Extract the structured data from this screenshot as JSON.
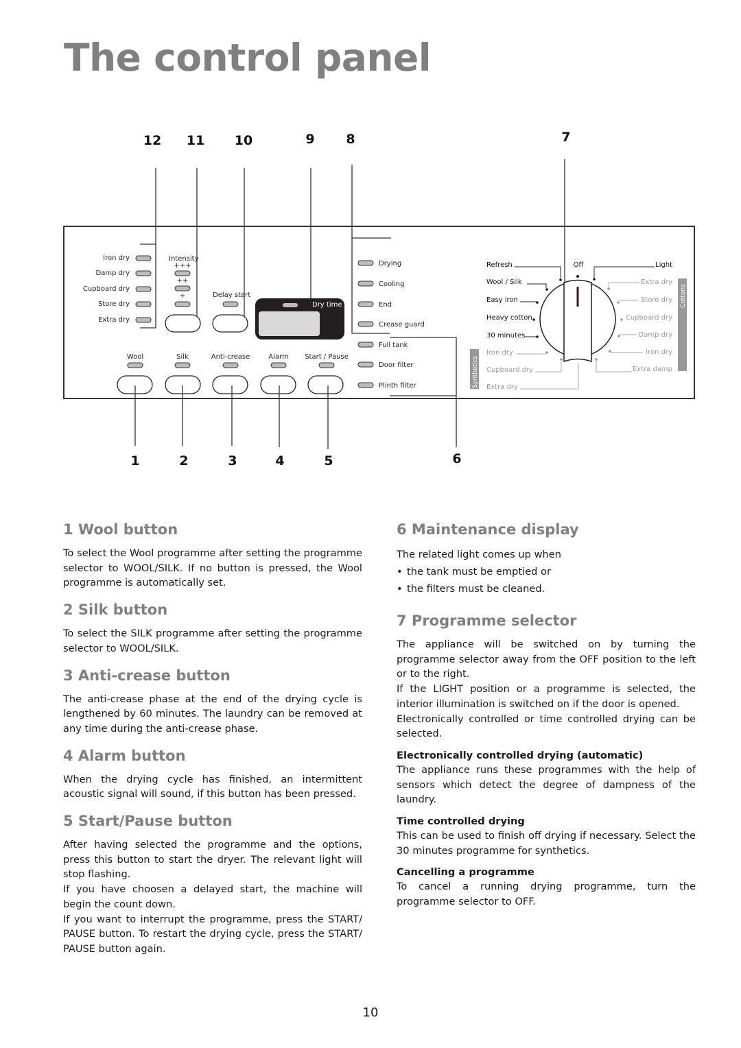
{
  "page": {
    "title": "The control panel",
    "page_number": "10"
  },
  "diagram": {
    "callouts_top": [
      "12",
      "11",
      "10",
      "9",
      "8",
      "7"
    ],
    "callouts_bottom": [
      "1",
      "2",
      "3",
      "4",
      "5",
      "6"
    ],
    "dryness_leds": [
      "Iron dry",
      "Damp dry",
      "Cupboard dry",
      "Store dry",
      "Extra dry"
    ],
    "intensity": {
      "label": "Intensity",
      "levels": [
        "+++",
        "++",
        "+"
      ]
    },
    "delay_start": "Delay start",
    "display": {
      "label": "Dry time"
    },
    "buttons": [
      "Wool",
      "Silk",
      "Anti-crease",
      "Alarm",
      "Start / Pause"
    ],
    "status_leds": [
      "Drying",
      "Cooling",
      "End",
      "Crease guard",
      "Full tank",
      "Door filter",
      "Plinth filter"
    ],
    "selector": {
      "top_label": "Off",
      "left_black": [
        "Refresh",
        "Wool / Silk",
        "Easy iron",
        "Heavy cotton",
        "30 minutes"
      ],
      "left_synthetics": [
        "Iron dry",
        "Cupboard dry",
        "Extra dry"
      ],
      "right_black": [
        "Light"
      ],
      "right_cottons": [
        "Extra dry",
        "Store dry",
        "Cupboard dry",
        "Damp dry",
        "Iron dry",
        "Extra damp"
      ],
      "group_left": "Synthetics",
      "group_right": "Cottons"
    }
  },
  "sections_left": [
    {
      "heading": "1 Wool button",
      "paragraphs": [
        "To select the Wool programme after setting the programme selector to WOOL/SILK. If no button is pressed, the Wool programme is automatically set."
      ]
    },
    {
      "heading": "2 Silk button",
      "paragraphs": [
        "To select the SILK programme after setting the programme selector to WOOL/SILK."
      ]
    },
    {
      "heading": "3 Anti-crease button",
      "paragraphs": [
        "The anti-crease phase at the end of the drying cycle is lengthened by 60 minutes. The laundry can be removed at any time during the anti-crease phase."
      ]
    },
    {
      "heading": "4 Alarm button",
      "paragraphs": [
        "When the drying cycle has finished, an intermittent acoustic signal will sound, if this button has been pressed."
      ]
    },
    {
      "heading": "5 Start/Pause button",
      "paragraphs": [
        "After having selected the programme and the options, press this button to start the dryer. The relevant light will stop flashing.",
        "If you have choosen a delayed start, the machine will begin the count down.",
        "If you want to interrupt the programme, press the START/ PAUSE button. To restart the drying cycle, press the START/ PAUSE button again."
      ]
    }
  ],
  "sections_right": {
    "maintenance": {
      "heading": "6 Maintenance display",
      "intro": "The related light comes up when",
      "bullets": [
        "the tank must be emptied or",
        "the filters must be cleaned."
      ]
    },
    "selector": {
      "heading": "7 Programme selector",
      "paragraphs": [
        "The appliance will be switched on by turning the programme selector away from the OFF position to the left or to the right.",
        "If the LIGHT position or a programme is selected, the interior illumination is switched on if the door is opened.",
        "Electronically controlled or time controlled drying can be selected."
      ],
      "subsections": [
        {
          "title": "Electronically controlled drying (automatic)",
          "text": "The appliance runs these programmes with the help of sensors which detect the degree of dampness of the laundry."
        },
        {
          "title": "Time controlled drying",
          "text": "This can be used to finish off drying if necessary. Select the 30 minutes programme for synthetics."
        },
        {
          "title": "Cancelling a programme",
          "text": "To cancel a running drying programme, turn the programme selector to OFF."
        }
      ]
    }
  }
}
